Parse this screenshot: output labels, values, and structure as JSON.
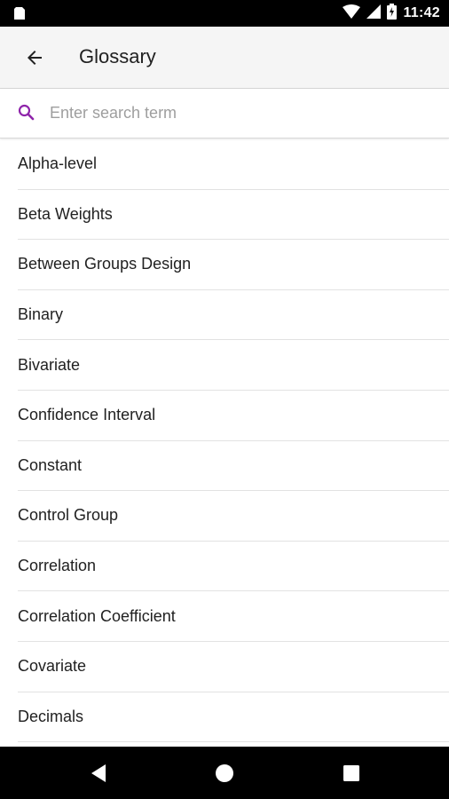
{
  "status_bar": {
    "time": "11:42",
    "icons": [
      "sim-icon",
      "wifi-icon",
      "signal-icon",
      "battery-icon"
    ]
  },
  "app_bar": {
    "title": "Glossary",
    "back_icon": "arrow-back-icon"
  },
  "search": {
    "placeholder": "Enter search term",
    "value": "",
    "icon": "search-icon",
    "accent_color": "#8e24aa"
  },
  "glossary": {
    "terms": [
      "Alpha-level",
      "Beta Weights",
      "Between Groups Design",
      "Binary",
      "Bivariate",
      "Confidence Interval",
      "Constant",
      "Control Group",
      "Correlation",
      "Correlation Coefficient",
      "Covariate",
      "Decimals"
    ]
  },
  "nav_bar": {
    "buttons": [
      "back-triangle-icon",
      "home-circle-icon",
      "recents-square-icon"
    ]
  }
}
